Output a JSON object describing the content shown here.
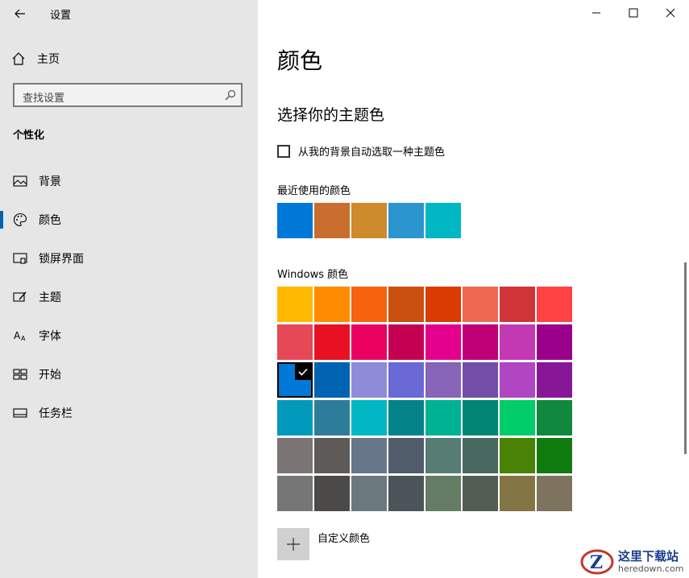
{
  "app": {
    "title": "设置"
  },
  "sidebar": {
    "home_label": "主页",
    "search_placeholder": "查找设置",
    "section_title": "个性化",
    "items": [
      {
        "label": "背景",
        "icon": "picture-icon"
      },
      {
        "label": "颜色",
        "icon": "palette-icon",
        "active": true
      },
      {
        "label": "锁屏界面",
        "icon": "lock-screen-icon"
      },
      {
        "label": "主题",
        "icon": "theme-icon"
      },
      {
        "label": "字体",
        "icon": "font-icon"
      },
      {
        "label": "开始",
        "icon": "start-icon"
      },
      {
        "label": "任务栏",
        "icon": "taskbar-icon"
      }
    ]
  },
  "main": {
    "title": "颜色",
    "subheading": "选择你的主题色",
    "auto_pick_label": "从我的背景自动选取一种主题色",
    "auto_pick_checked": false,
    "recent_label": "最近使用的颜色",
    "recent_colors": [
      "#0078d7",
      "#c96e2e",
      "#cd8b2c",
      "#2b95d0",
      "#00b7c3"
    ],
    "windows_label": "Windows 颜色",
    "windows_colors": [
      [
        "#ffb900",
        "#ff8c00",
        "#f7630c",
        "#ca5010",
        "#da3b01",
        "#ef6950",
        "#d13438",
        "#ff4343"
      ],
      [
        "#e74856",
        "#e81123",
        "#ea005e",
        "#c30052",
        "#e3008c",
        "#bf0077",
        "#c239b3",
        "#9a0089"
      ],
      [
        "#0078d7",
        "#0063b1",
        "#8e8cd8",
        "#6b69d6",
        "#8764b8",
        "#744da9",
        "#b146c2",
        "#881798"
      ],
      [
        "#0099bc",
        "#2d7d9a",
        "#00b7c3",
        "#038387",
        "#00b294",
        "#018574",
        "#00cc6a",
        "#10893e"
      ],
      [
        "#7a7574",
        "#5d5a58",
        "#68768a",
        "#515c6b",
        "#567c73",
        "#486860",
        "#498205",
        "#107c10"
      ],
      [
        "#767676",
        "#4c4a48",
        "#69797e",
        "#4a5459",
        "#647c64",
        "#525e54",
        "#847545",
        "#7e735f"
      ]
    ],
    "selected_color": "#0078d7",
    "custom_label": "自定义颜色"
  },
  "watermark": {
    "text": "这里下载站",
    "subtext": "heredown.com"
  }
}
